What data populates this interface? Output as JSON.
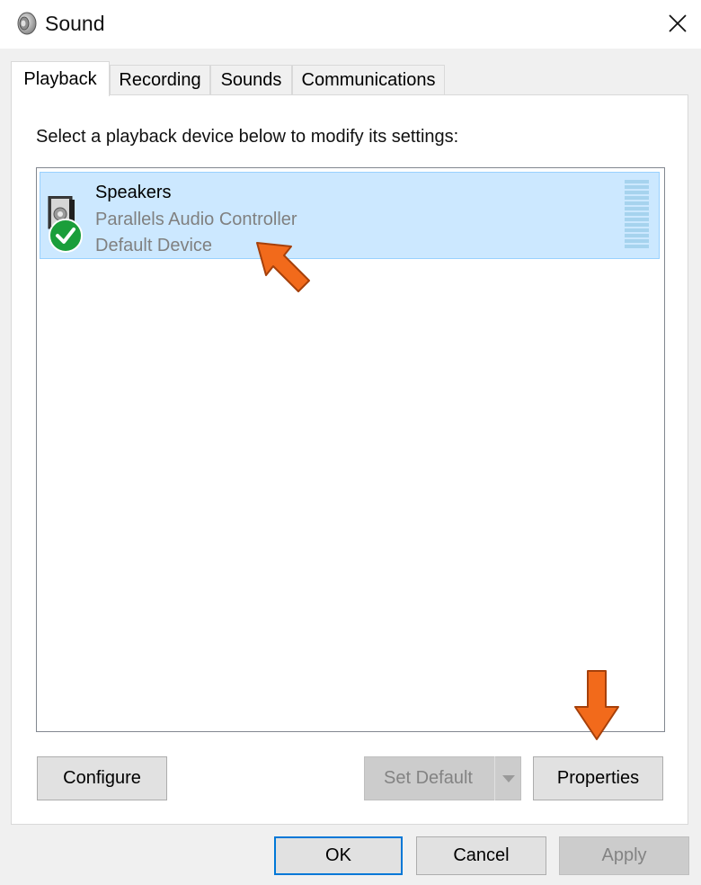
{
  "window": {
    "title": "Sound",
    "title_icon": "speaker-icon",
    "close_icon": "close-icon"
  },
  "tabs": [
    {
      "label": "Playback",
      "active": true
    },
    {
      "label": "Recording",
      "active": false
    },
    {
      "label": "Sounds",
      "active": false
    },
    {
      "label": "Communications",
      "active": false
    }
  ],
  "instruction": "Select a playback device below to modify its settings:",
  "devices": [
    {
      "name": "Speakers",
      "controller": "Parallels Audio Controller",
      "status": "Default Device",
      "icon": "speaker-device-icon",
      "badge_icon": "green-check-icon",
      "selected": true,
      "level_bars": 13
    }
  ],
  "buttons": {
    "configure": "Configure",
    "set_default": "Set Default",
    "properties": "Properties",
    "ok": "OK",
    "cancel": "Cancel",
    "apply": "Apply"
  },
  "annotations": [
    {
      "icon": "orange-arrow-icon",
      "target": "device-speakers"
    },
    {
      "icon": "orange-arrow-down-icon",
      "target": "properties-button"
    }
  ],
  "colors": {
    "selection": "#cce8ff",
    "selection_border": "#99d1ff",
    "check_badge": "#1a9e3a",
    "annotation_arrow": "#f26a1b",
    "focus_border": "#0078d7"
  }
}
